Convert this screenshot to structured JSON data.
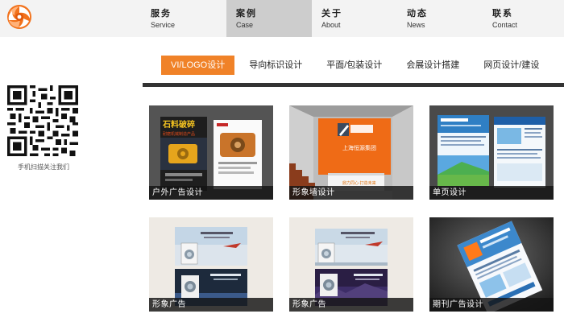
{
  "nav": {
    "items": [
      {
        "zh": "服务",
        "en": "Service"
      },
      {
        "zh": "案例",
        "en": "Case"
      },
      {
        "zh": "关于",
        "en": "About"
      },
      {
        "zh": "动态",
        "en": "News"
      },
      {
        "zh": "联系",
        "en": "Contact"
      }
    ],
    "active_index": 1
  },
  "sidebar": {
    "qr_caption": "手机扫描关注我们"
  },
  "tabs": {
    "items": [
      "VI/LOGO设计",
      "导向标识设计",
      "平面/包装设计",
      "会展设计搭建",
      "网页设计/建设"
    ],
    "active_index": 0
  },
  "cards": [
    {
      "label": "户外广告设计",
      "image_text": [
        "石料破碎",
        "耐磨机械制造产品"
      ]
    },
    {
      "label": "形象墙设计",
      "image_text": [
        "上海恒源集团",
        "鼎力同心·打造未来"
      ]
    },
    {
      "label": "单页设计"
    },
    {
      "label": "形象广告"
    },
    {
      "label": "形象广告"
    },
    {
      "label": "期刊广告设计"
    }
  ],
  "colors": {
    "accent": "#f08228",
    "nav_bg": "#f3f3f3",
    "nav_active_bg": "#cdcdcd",
    "divider": "#333333",
    "label_bg": "#141414"
  },
  "icons": {
    "logo": "orange-swirl-logo",
    "qr": "qr-code"
  }
}
